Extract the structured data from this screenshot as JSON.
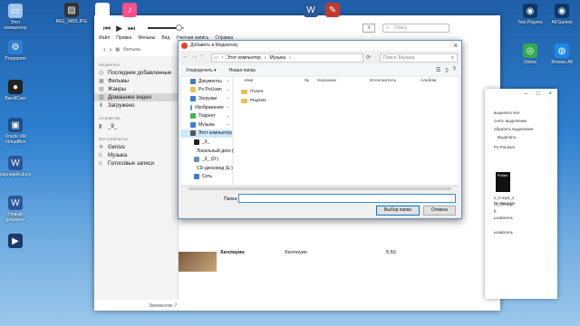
{
  "desktop": {
    "icons_left": [
      {
        "label": "Этот компьютер",
        "icon": "computer-icon",
        "color": "#9fc6ec"
      },
      {
        "label": "Programm",
        "icon": "gear-icon",
        "color": "#2d7fd0"
      },
      {
        "label": "BandiCam",
        "icon": "record-icon",
        "color": "#222222"
      },
      {
        "label": "Oracle VM VirtualBox",
        "icon": "virtualbox-icon",
        "color": "#1c4f8a"
      },
      {
        "label": "сценарий.docx",
        "icon": "word-doc-icon",
        "color": "#2b579a"
      },
      {
        "label": "Новый документ",
        "icon": "word-doc-icon",
        "color": "#2b579a"
      },
      {
        "label": "",
        "icon": "media-player-icon",
        "color": "#1a3a6b"
      }
    ],
    "icons_top": [
      {
        "label": "IMG_3459.JPG",
        "icon": "photo-icon",
        "color": "#333333"
      },
      {
        "label": "",
        "icon": "file-icon",
        "color": "#ffffff"
      },
      {
        "label": "",
        "icon": "itunes-icon",
        "color": "#ff4f8b"
      },
      {
        "label": "",
        "icon": "word-doc-icon",
        "color": "#2b579a"
      },
      {
        "label": "",
        "icon": "tool-icon",
        "color": "#c0392b"
      }
    ],
    "icons_right": [
      {
        "label": "Two Players",
        "icon": "steam-icon",
        "color": "#0b3a66"
      },
      {
        "label": "All Games",
        "icon": "steam-icon",
        "color": "#0b3a66"
      },
      {
        "label": "Online",
        "icon": "chrome-icon",
        "color": "#34a853"
      },
      {
        "label": "Browse All",
        "icon": "browser-icon",
        "color": "#1e88e5"
      }
    ]
  },
  "itunes": {
    "menu": [
      "Файл",
      "Правка",
      "Фильмы",
      "Вид",
      "Учетная запись",
      "Справка"
    ],
    "volume_fraction": 0.85,
    "nav_breadcrumb": "Фильмы",
    "search_placeholder": "Поиск",
    "sidebar": {
      "section_library": "Медиатека",
      "library_items": [
        "Последние добавленные",
        "Фильмы",
        "Жанры",
        "Домашнее видео",
        "Загружено"
      ],
      "section_devices": "Устройства",
      "device_name": "_9_",
      "section_playlists": "Все плейлисты",
      "playlist_items": [
        "Genius",
        "Музыка",
        "Голосовые записи"
      ]
    },
    "row": {
      "title": "Хеллоуин",
      "album": "Хеллоуин",
      "time": "5:50"
    },
    "status": "Элементов: 7"
  },
  "rightwin": {
    "lines": [
      "выделить все",
      "снять выделение",
      "обратить выделение",
      "Выделить"
    ],
    "lines2": [
      "Po PoLkam",
      "e_0.mp4_s",
      "ot_0003.jp",
      "g"
    ],
    "lines3": [
      "Po PoLkam",
      "ьзователь",
      "ьзователь"
    ],
    "thumb_text": "PoSkm"
  },
  "dialog": {
    "title": "Добавить в Медиатеку",
    "address": [
      "Этот компьютер",
      "Музыка"
    ],
    "search_placeholder": "Поиск: Музыка",
    "organize": "Упорядочить",
    "new_folder": "Новая папка",
    "nav_items": [
      {
        "label": "Документы",
        "icon": "documents-icon",
        "color": "#4a7ab5",
        "pinned": true
      },
      {
        "label": "Po PoLkam",
        "icon": "folder-icon",
        "color": "#e8c15a",
        "pinned": true
      },
      {
        "label": "Загрузки",
        "icon": "downloads-icon",
        "color": "#3a7bd5",
        "pinned": true
      },
      {
        "label": "Изображения",
        "icon": "pictures-icon",
        "color": "#5a9bd5",
        "pinned": true
      },
      {
        "label": "Торрент",
        "icon": "torrent-icon",
        "color": "#4caf50",
        "pinned": true
      },
      {
        "label": "Музыка",
        "icon": "music-icon",
        "color": "#3c7ddc",
        "pinned": true
      },
      {
        "label": "Этот компьютер",
        "icon": "computer-icon",
        "color": "#555555",
        "pinned": false
      },
      {
        "label": "_9_",
        "icon": "phone-icon",
        "color": "#222222",
        "pinned": false
      },
      {
        "label": "Локальный диск (C:)",
        "icon": "drive-icon",
        "color": "#6a8fb5",
        "pinned": false
      },
      {
        "label": "_9_ (D:)",
        "icon": "drive-icon",
        "color": "#6a8fb5",
        "pinned": false
      },
      {
        "label": "CD-дисковод (E:)",
        "icon": "cd-icon",
        "color": "#888888",
        "pinned": false
      },
      {
        "label": "Сеть",
        "icon": "network-icon",
        "color": "#3a7bd5",
        "pinned": false
      }
    ],
    "columns": [
      "Имя",
      "№",
      "Название",
      "Исполнитель",
      "Альбом"
    ],
    "files": [
      "iTunes",
      "Playlists"
    ],
    "filename_label": "Папка:",
    "select_folder": "Выбор папки",
    "cancel": "Отмена"
  }
}
